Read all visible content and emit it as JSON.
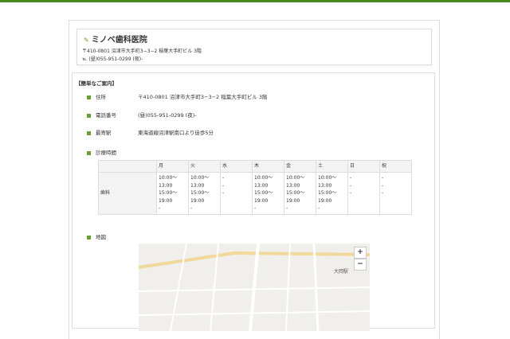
{
  "clinic": {
    "name": "ミノベ歯科医院",
    "address": "〒410-0801 沼津市大手町3−3−2 稲葉大手町ビル 3階",
    "tel": "℡ (昼)055-951-0299 (夜)-"
  },
  "section_title": "【簡単なご案内】",
  "info": [
    {
      "label": "住所",
      "value": "〒410-0801 沼津市大手町3−3−2 稲葉大手町ビル 3階"
    },
    {
      "label": "電話番号",
      "value": "(昼)055-951-0299 (夜)-"
    },
    {
      "label": "最寄駅",
      "value": "東海道線沼津駅南口より徒歩5分"
    }
  ],
  "hours": {
    "label": "診療時間",
    "days": [
      "月",
      "火",
      "水",
      "木",
      "金",
      "土",
      "日",
      "祝"
    ],
    "row_label": "歯科",
    "cells": [
      "10:00〜\n13:00\n15:00〜\n19:00\n-",
      "10:00〜\n13:00\n15:00〜\n19:00\n-",
      "-\n-\n-",
      "10:00〜\n13:00\n15:00〜\n19:00\n-",
      "10:00〜\n13:00\n15:00〜\n19:00\n-",
      "10:00〜\n13:00\n15:00〜\n19:00\n-",
      "-\n-\n-",
      "-\n-\n-"
    ]
  },
  "map": {
    "label": "地図",
    "zoom_in": "+",
    "zoom_out": "−",
    "station": "大岡駅"
  }
}
